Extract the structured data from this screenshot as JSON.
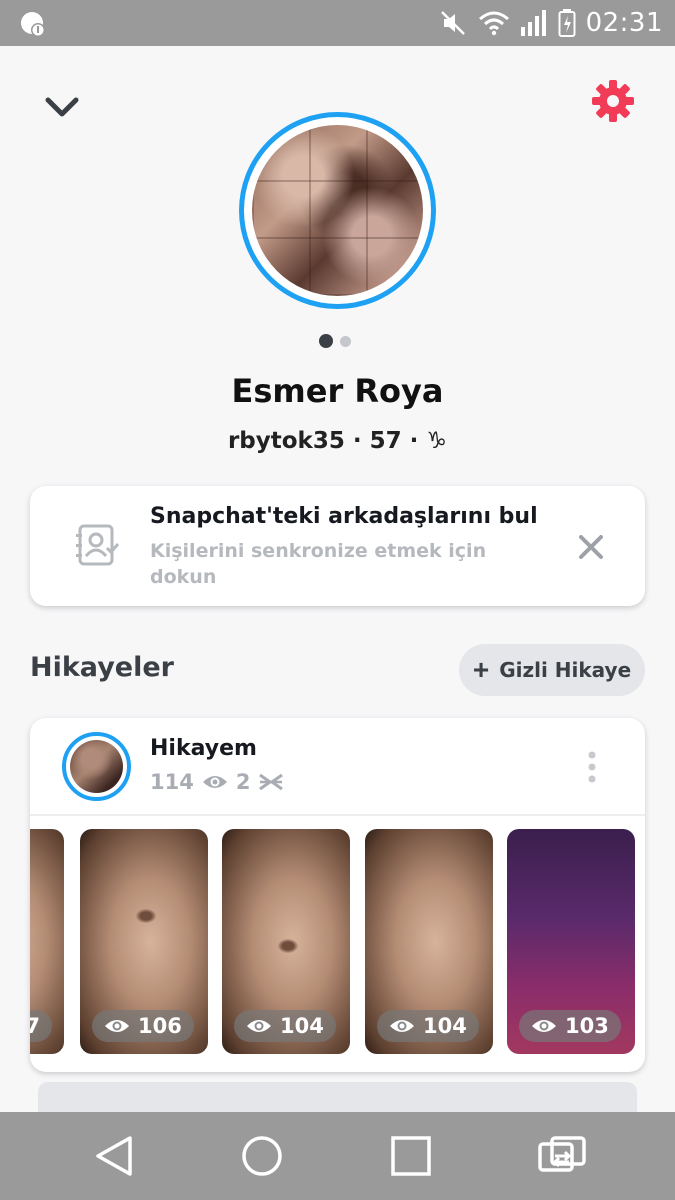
{
  "status_bar": {
    "time": "02:31",
    "icons": [
      "notification-icon",
      "mute-icon",
      "wifi-icon",
      "signal-icon",
      "battery-icon"
    ]
  },
  "header": {
    "back_icon": "chevron-down-icon",
    "settings_icon": "gear-icon",
    "accent_color": "#f23c57"
  },
  "profile": {
    "display_name": "Esmer Roya",
    "username": "rbytok35",
    "score": "57",
    "zodiac": "♑",
    "separator": "·",
    "ring_color": "#1ea1f2",
    "pager": {
      "count": 2,
      "active": 0
    }
  },
  "find_friends": {
    "title": "Snapchat'teki arkadaşlarını bul",
    "subtitle": "Kişilerini senkronize etmek için dokun",
    "icon": "contacts-icon",
    "close_icon": "close-icon"
  },
  "stories": {
    "section_title": "Hikayeler",
    "private_story_button": "Gizli Hikaye",
    "my_story": {
      "title": "Hikayem",
      "views": "114",
      "screenshots": "2"
    },
    "snaps": [
      {
        "views": "7"
      },
      {
        "views": "106"
      },
      {
        "views": "104"
      },
      {
        "views": "104"
      },
      {
        "views": "103"
      }
    ]
  },
  "nav_bar": {
    "icons": [
      "back-icon",
      "home-icon",
      "recents-icon",
      "screen-rotate-icon"
    ]
  }
}
